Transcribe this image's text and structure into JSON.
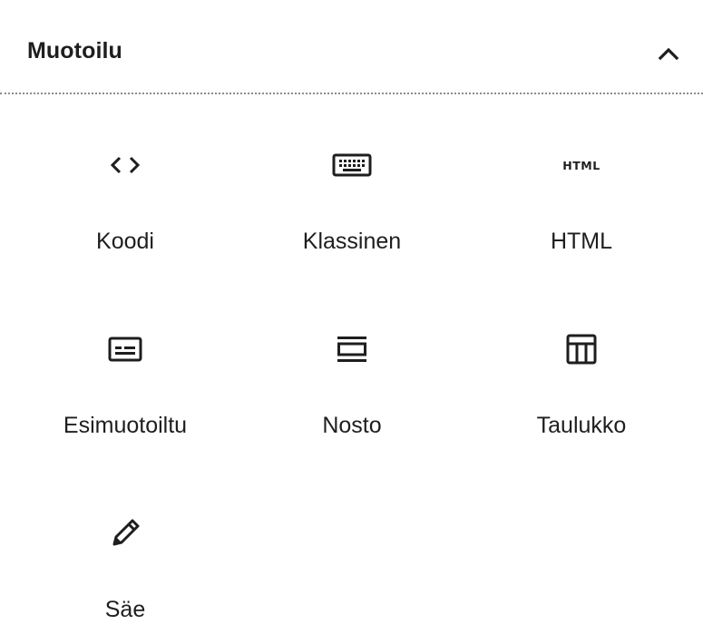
{
  "panel": {
    "title": "Muotoilu",
    "toggle_icon": "chevron-up-icon"
  },
  "blocks": [
    {
      "label": "Koodi",
      "icon": "code-icon"
    },
    {
      "label": "Klassinen",
      "icon": "keyboard-icon"
    },
    {
      "label": "HTML",
      "icon": "html-icon",
      "icon_text": "HTML"
    },
    {
      "label": "Esimuotoiltu",
      "icon": "preformatted-icon"
    },
    {
      "label": "Nosto",
      "icon": "pullquote-icon"
    },
    {
      "label": "Taulukko",
      "icon": "table-icon"
    },
    {
      "label": "Säe",
      "icon": "pencil-icon"
    }
  ]
}
